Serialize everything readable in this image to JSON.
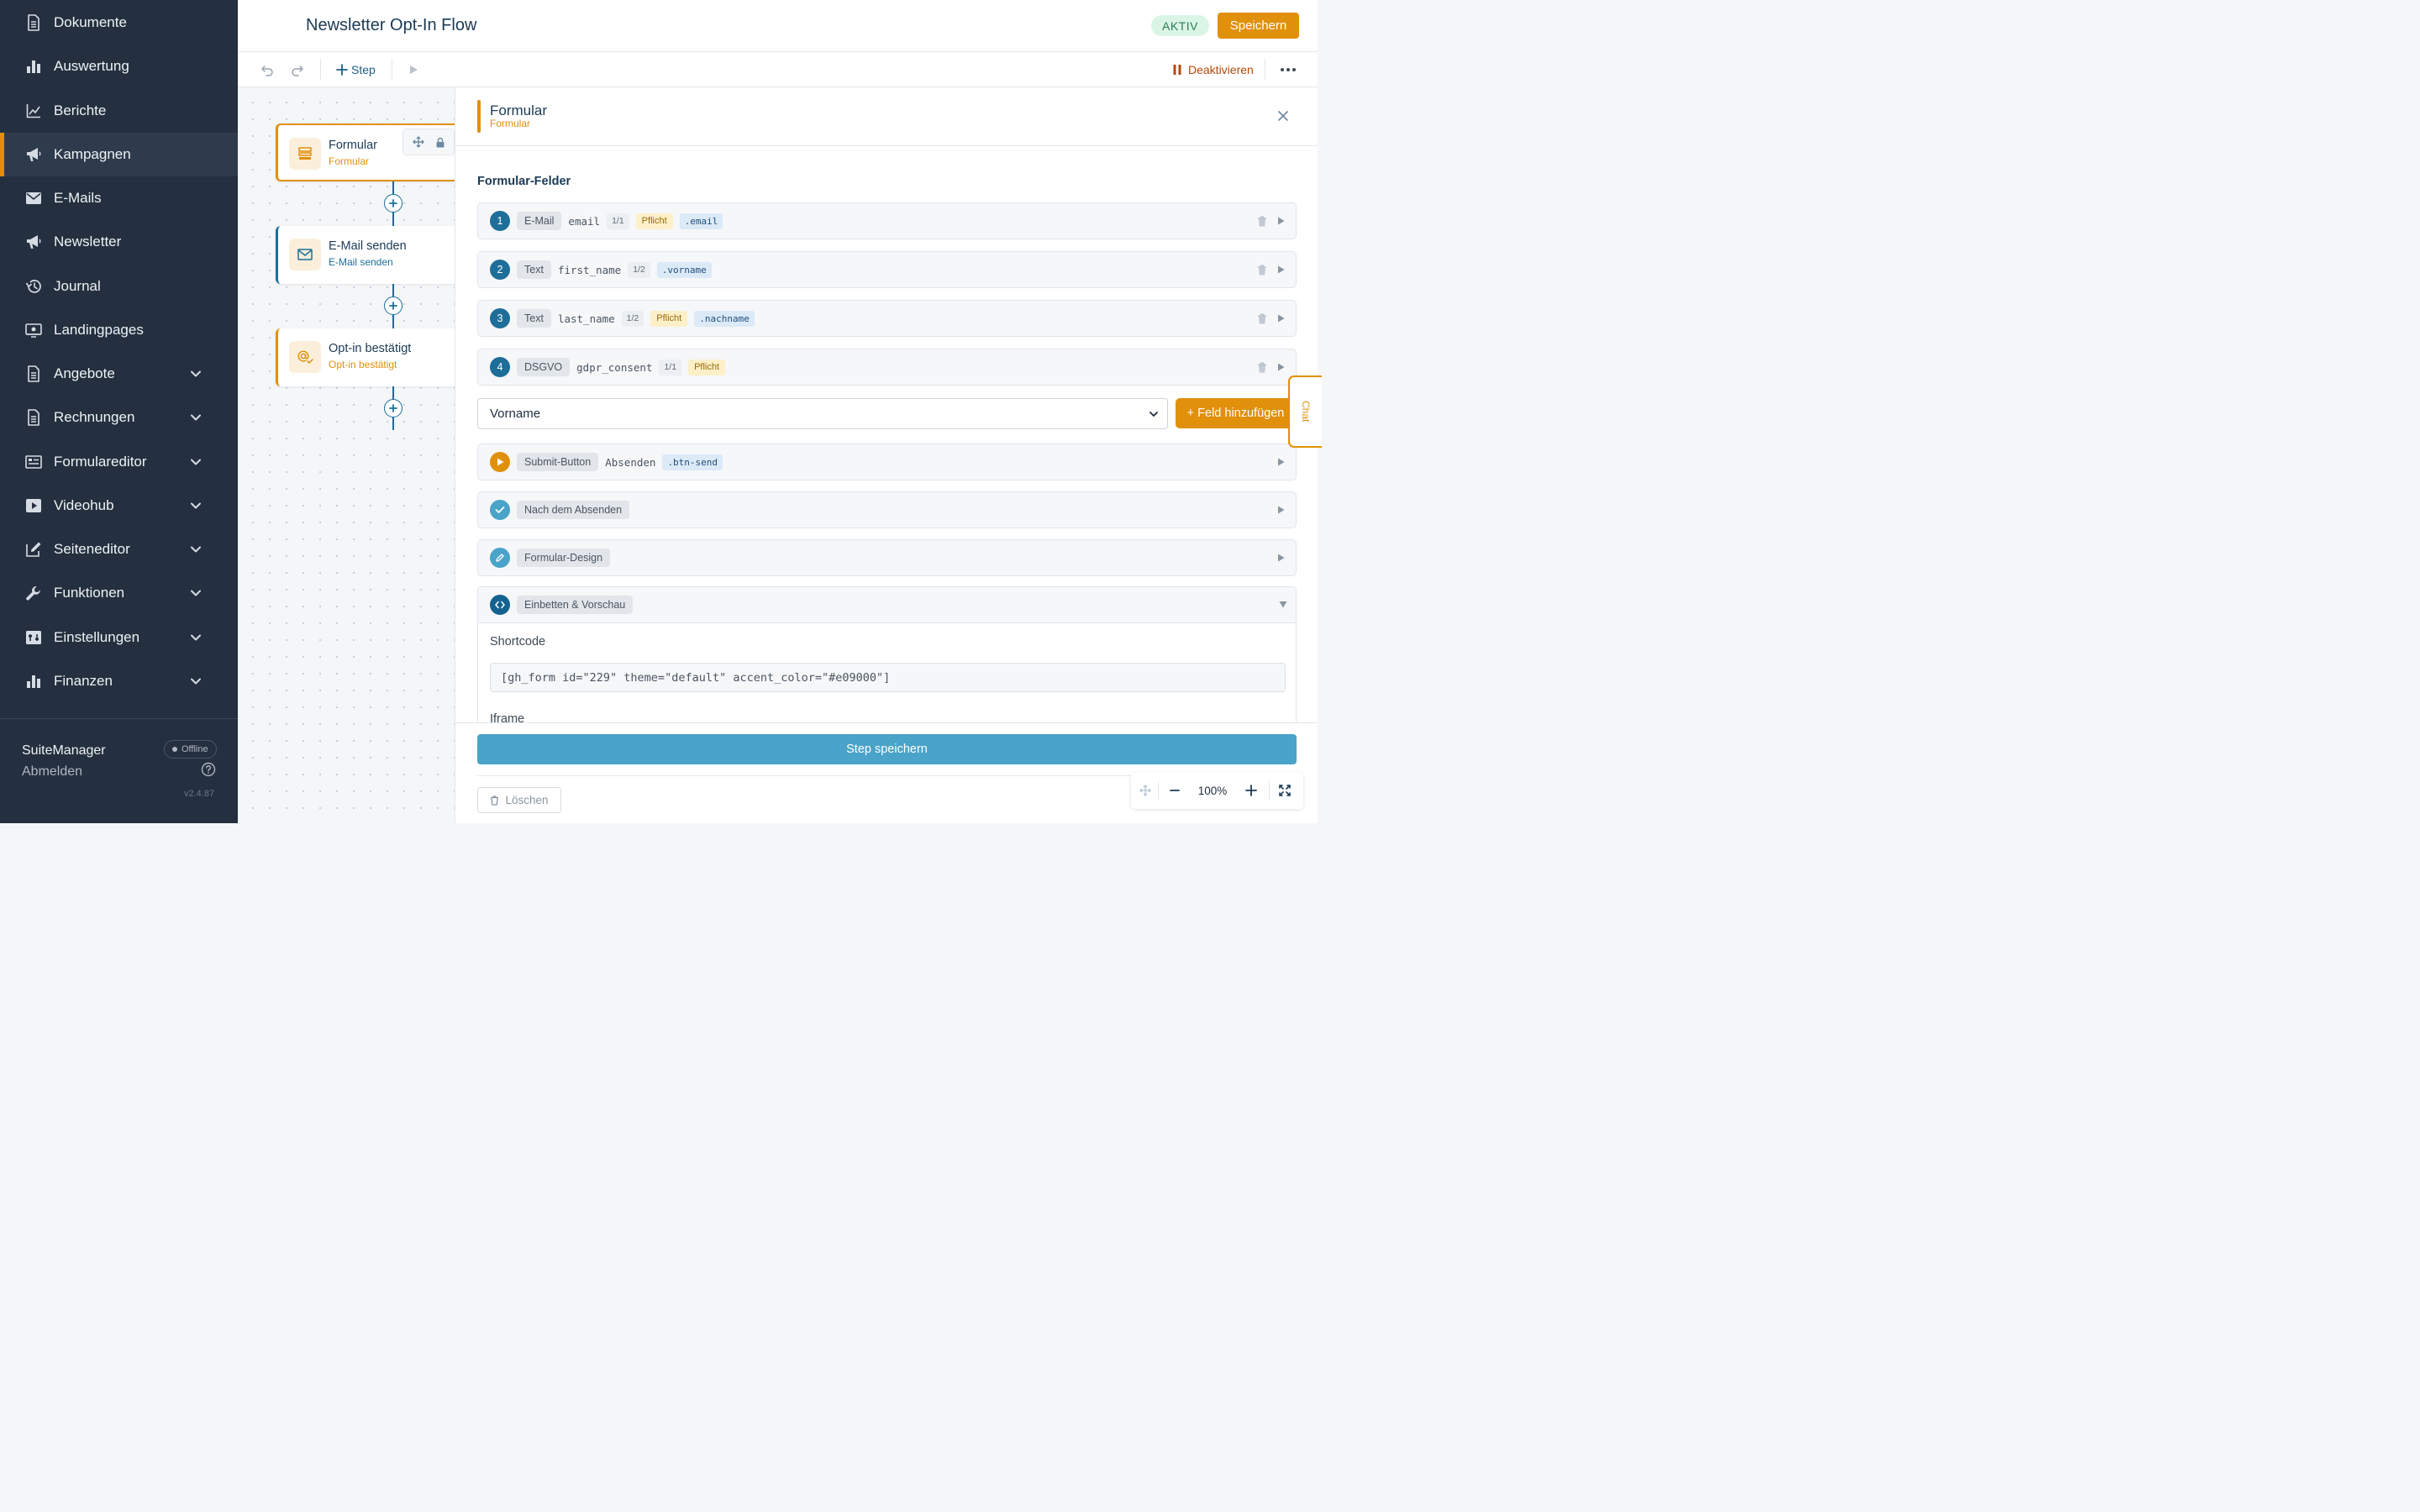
{
  "sidebar": {
    "items": [
      {
        "label": "Dokumente",
        "icon": "document-icon",
        "has_chevron": false,
        "active": false
      },
      {
        "label": "Auswertung",
        "icon": "bar-chart-icon",
        "has_chevron": false,
        "active": false
      },
      {
        "label": "Berichte",
        "icon": "line-chart-icon",
        "has_chevron": false,
        "active": false
      },
      {
        "label": "Kampagnen",
        "icon": "megaphone-icon",
        "has_chevron": false,
        "active": true
      },
      {
        "label": "E-Mails",
        "icon": "envelope-icon",
        "has_chevron": false,
        "active": false
      },
      {
        "label": "Newsletter",
        "icon": "megaphone-icon",
        "has_chevron": false,
        "active": false
      },
      {
        "label": "Journal",
        "icon": "history-icon",
        "has_chevron": false,
        "active": false
      },
      {
        "label": "Landingpages",
        "icon": "landingpage-icon",
        "has_chevron": false,
        "active": false
      },
      {
        "label": "Angebote",
        "icon": "document-icon",
        "has_chevron": true,
        "active": false
      },
      {
        "label": "Rechnungen",
        "icon": "document-icon",
        "has_chevron": true,
        "active": false
      },
      {
        "label": "Formulareditor",
        "icon": "form-icon",
        "has_chevron": true,
        "active": false
      },
      {
        "label": "Videohub",
        "icon": "video-icon",
        "has_chevron": true,
        "active": false
      },
      {
        "label": "Seiteneditor",
        "icon": "edit-page-icon",
        "has_chevron": true,
        "active": false
      },
      {
        "label": "Funktionen",
        "icon": "wrench-icon",
        "has_chevron": true,
        "active": false
      },
      {
        "label": "Einstellungen",
        "icon": "settings-icon",
        "has_chevron": true,
        "active": false
      },
      {
        "label": "Finanzen",
        "icon": "bar-chart-icon",
        "has_chevron": true,
        "active": false
      }
    ],
    "footer": {
      "user": "SuiteManager",
      "logout": "Abmelden",
      "status": "Offline",
      "version": "v2.4.87"
    }
  },
  "header": {
    "title": "Newsletter Opt-In Flow",
    "status": "AKTIV",
    "save_label": "Speichern"
  },
  "toolbar": {
    "add_step_label": "Step",
    "deactivate_label": "Deaktivieren"
  },
  "flow": {
    "nodes": [
      {
        "title": "Formular",
        "subtitle": "Formular",
        "icon": "form-stack-icon"
      },
      {
        "title": "E-Mail senden",
        "subtitle": "E-Mail senden",
        "icon": "envelope-icon"
      },
      {
        "title": "Opt-in bestätigt",
        "subtitle": "Opt-in bestätigt",
        "icon": "at-check-icon"
      }
    ]
  },
  "panel": {
    "title": "Formular",
    "subtitle": "Formular",
    "section_title": "Formular-Felder",
    "fields": [
      {
        "num": "1",
        "type": "E-Mail",
        "name": "email",
        "width": "1/1",
        "required": "Pflicht",
        "css_class": ".email"
      },
      {
        "num": "2",
        "type": "Text",
        "name": "first_name",
        "width": "1/2",
        "required": "",
        "css_class": ".vorname"
      },
      {
        "num": "3",
        "type": "Text",
        "name": "last_name",
        "width": "1/2",
        "required": "Pflicht",
        "css_class": ".nachname"
      },
      {
        "num": "4",
        "type": "DSGVO",
        "name": "gdpr_consent",
        "width": "1/1",
        "required": "Pflicht",
        "css_class": ""
      }
    ],
    "field_select_value": "Vorname",
    "add_field_label": "+ Feld hinzufügen",
    "submit": {
      "type": "Submit-Button",
      "label": "Absenden",
      "css_class": ".btn-send"
    },
    "after_submit_label": "Nach dem Absenden",
    "design_label": "Formular-Design",
    "embed": {
      "label": "Einbetten & Vorschau",
      "shortcode_label": "Shortcode",
      "shortcode": "[gh_form id=\"229\" theme=\"default\" accent_color=\"#e09000\"]",
      "iframe_label": "Iframe"
    },
    "save_step_label": "Step speichern",
    "delete_label": "Löschen"
  },
  "zoom": {
    "level": "100%"
  },
  "chat_label": "Chat",
  "colors": {
    "sidebar_bg": "#24303f",
    "accent_orange": "#e0900a",
    "primary_blue": "#1d6e98",
    "step_save_blue": "#4aa3c8",
    "status_green_bg": "#daf5e6"
  }
}
